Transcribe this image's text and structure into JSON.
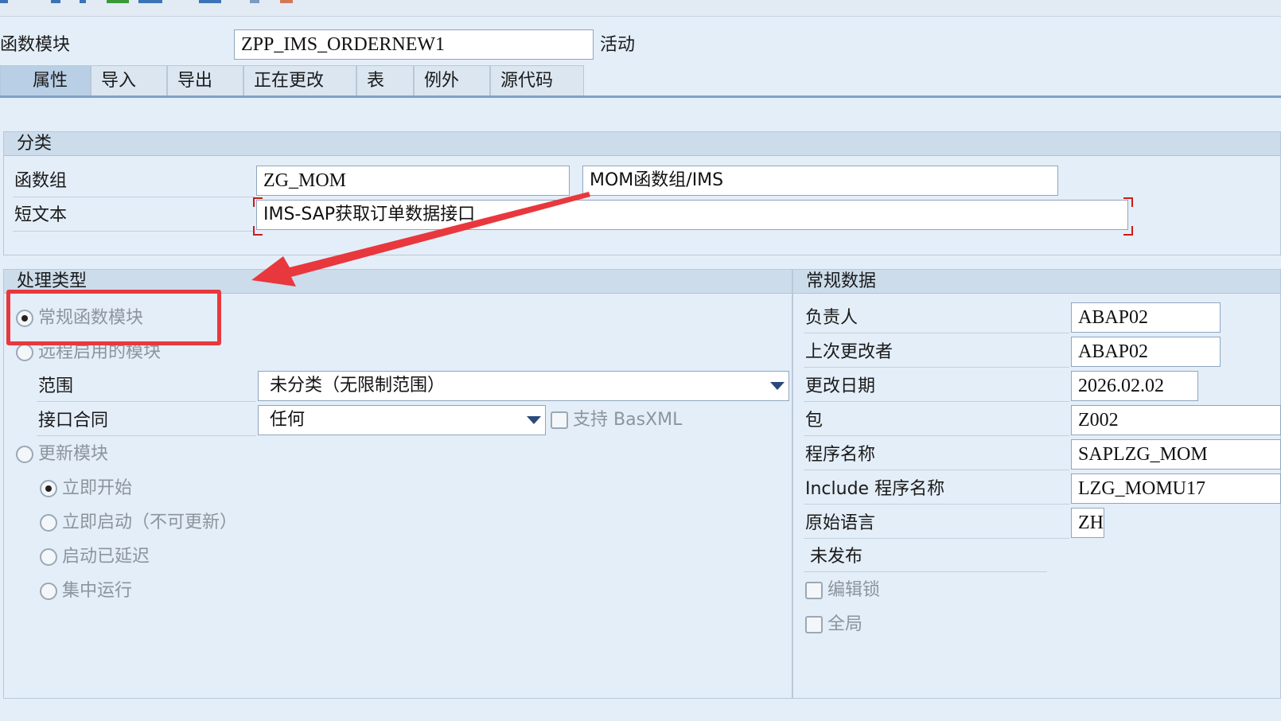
{
  "header": {
    "label": "函数模块",
    "value": "ZPP_IMS_ORDERNEW1",
    "status": "活动"
  },
  "tabs": [
    {
      "label": "属性",
      "active": true
    },
    {
      "label": "导入"
    },
    {
      "label": "导出"
    },
    {
      "label": "正在更改"
    },
    {
      "label": "表"
    },
    {
      "label": "例外"
    },
    {
      "label": "源代码"
    }
  ],
  "classification": {
    "title": "分类",
    "function_group_label": "函数组",
    "function_group_value": "ZG_MOM",
    "function_group_desc": "MOM函数组/IMS",
    "short_text_label": "短文本",
    "short_text_value": "IMS-SAP获取订单数据接口"
  },
  "processing": {
    "title": "处理类型",
    "normal_module": "常规函数模块",
    "remote_module": "远程启用的模块",
    "scope_label": "范围",
    "scope_value": "未分类（无限制范围）",
    "interface_label": "接口合同",
    "interface_value": "任何",
    "basxml_label": "支持 BasXML",
    "update_module": "更新模块",
    "start_immediately": "立即开始",
    "start_immediately_no_update": "立即启动（不可更新）",
    "start_delayed": "启动已延迟",
    "collective_run": "集中运行"
  },
  "general": {
    "title": "常规数据",
    "responsible_label": "负责人",
    "responsible_value": "ABAP02",
    "last_changed_by_label": "上次更改者",
    "last_changed_by_value": "ABAP02",
    "changed_on_label": "更改日期",
    "changed_on_value": "2026.02.02",
    "package_label": "包",
    "package_value": "Z002",
    "program_label": "程序名称",
    "program_value": "SAPLZG_MOM",
    "include_label": "Include 程序名称",
    "include_value": "LZG_MOMU17",
    "language_label": "原始语言",
    "language_value": "ZH",
    "release_status": "未发布",
    "edit_lock": "编辑锁",
    "global": "全局"
  },
  "colors": {
    "annotation_red": "#e8383d",
    "background": "#e4eef8"
  }
}
